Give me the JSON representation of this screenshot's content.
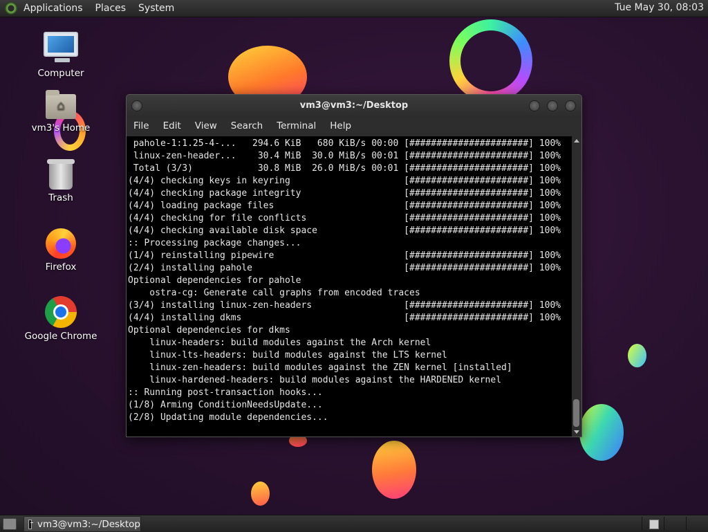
{
  "top_panel": {
    "menus": [
      "Applications",
      "Places",
      "System"
    ],
    "clock": "Tue May 30, 08:03"
  },
  "desktop_icons": [
    {
      "label": "Computer",
      "icon": "computer-icon"
    },
    {
      "label": "vm3's Home",
      "icon": "home-folder-icon"
    },
    {
      "label": "Trash",
      "icon": "trash-icon"
    },
    {
      "label": "Firefox",
      "icon": "firefox-icon"
    },
    {
      "label": "Google Chrome",
      "icon": "chrome-icon"
    }
  ],
  "terminal": {
    "title": "vm3@vm3:~/Desktop",
    "menu": [
      "File",
      "Edit",
      "View",
      "Search",
      "Terminal",
      "Help"
    ],
    "lines": [
      " pahole-1:1.25-4-...   294.6 KiB   680 KiB/s 00:00 [######################] 100%",
      " linux-zen-header...    30.4 MiB  30.0 MiB/s 00:01 [######################] 100%",
      " Total (3/3)            30.8 MiB  26.0 MiB/s 00:01 [######################] 100%",
      "(4/4) checking keys in keyring                     [######################] 100%",
      "(4/4) checking package integrity                   [######################] 100%",
      "(4/4) loading package files                        [######################] 100%",
      "(4/4) checking for file conflicts                  [######################] 100%",
      "(4/4) checking available disk space                [######################] 100%",
      ":: Processing package changes...",
      "(1/4) reinstalling pipewire                        [######################] 100%",
      "(2/4) installing pahole                            [######################] 100%",
      "Optional dependencies for pahole",
      "    ostra-cg: Generate call graphs from encoded traces",
      "(3/4) installing linux-zen-headers                 [######################] 100%",
      "(4/4) installing dkms                              [######################] 100%",
      "Optional dependencies for dkms",
      "    linux-headers: build modules against the Arch kernel",
      "    linux-lts-headers: build modules against the LTS kernel",
      "    linux-zen-headers: build modules against the ZEN kernel [installed]",
      "    linux-hardened-headers: build modules against the HARDENED kernel",
      ":: Running post-transaction hooks...",
      "(1/8) Arming ConditionNeedsUpdate...",
      "(2/8) Updating module dependencies..."
    ]
  },
  "taskbar": {
    "task_label": "vm3@vm3:~/Desktop"
  }
}
